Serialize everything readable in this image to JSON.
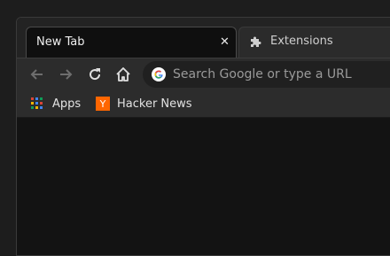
{
  "tabs": [
    {
      "title": "New Tab",
      "close_glyph": "✕",
      "active": true
    },
    {
      "title": "Extensions",
      "icon": "puzzle-icon",
      "active": false
    }
  ],
  "toolbar": {
    "back_icon": "arrow-left-icon",
    "forward_icon": "arrow-right-icon",
    "reload_icon": "reload-icon",
    "home_icon": "home-icon",
    "omnibox_placeholder": "Search Google or type a URL"
  },
  "bookmarks": [
    {
      "label": "Apps",
      "icon": "apps-grid-icon"
    },
    {
      "label": "Hacker News",
      "icon": "hacker-news-icon",
      "icon_letter": "Y"
    }
  ],
  "colors": {
    "hn_orange": "#ff6600",
    "apps_grid": [
      "#db4437",
      "#4285f4",
      "#0f9d58",
      "#f4b400",
      "#4285f4",
      "#db4437",
      "#0f9d58",
      "#f4b400",
      "#4285f4"
    ]
  }
}
